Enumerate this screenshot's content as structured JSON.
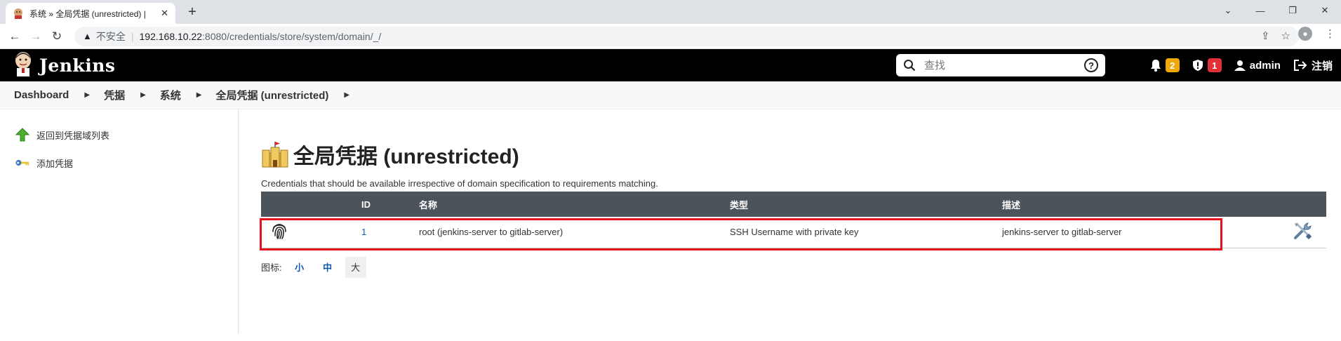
{
  "browser": {
    "tab_title": "系统 » 全局凭据 (unrestricted) |",
    "insecure_label": "不安全",
    "url_host": "192.168.10.22",
    "url_path": ":8080/credentials/store/system/domain/_/"
  },
  "header": {
    "logo_text": "Jenkins",
    "search_placeholder": "查找",
    "notifications_count": "2",
    "security_count": "1",
    "user": "admin",
    "logout": "注销"
  },
  "breadcrumb": [
    "Dashboard",
    "凭据",
    "系统",
    "全局凭据 (unrestricted)"
  ],
  "sidebar": {
    "items": [
      {
        "label": "返回到凭据域列表",
        "icon": "up-arrow-icon"
      },
      {
        "label": "添加凭据",
        "icon": "key-icon"
      }
    ]
  },
  "main": {
    "title": "全局凭据 (unrestricted)",
    "description": "Credentials that should be available irrespective of domain specification to requirements matching.",
    "table": {
      "headers": [
        "",
        "ID",
        "名称",
        "类型",
        "描述",
        ""
      ],
      "rows": [
        {
          "icon": "fingerprint-icon",
          "id": "1",
          "name": "root (jenkins-server to gitlab-server)",
          "type": "SSH Username with private key",
          "description": "jenkins-server to gitlab-server",
          "action_icon": "configure-tools-icon"
        }
      ]
    },
    "icon_legend": {
      "label": "图标:",
      "sizes": [
        "小",
        "中",
        "大"
      ],
      "selected": "大"
    }
  },
  "colors": {
    "header_bg": "#000000",
    "table_header_bg": "#4b535b",
    "highlight_box": "#e4121c",
    "link": "#0b5aa8"
  }
}
